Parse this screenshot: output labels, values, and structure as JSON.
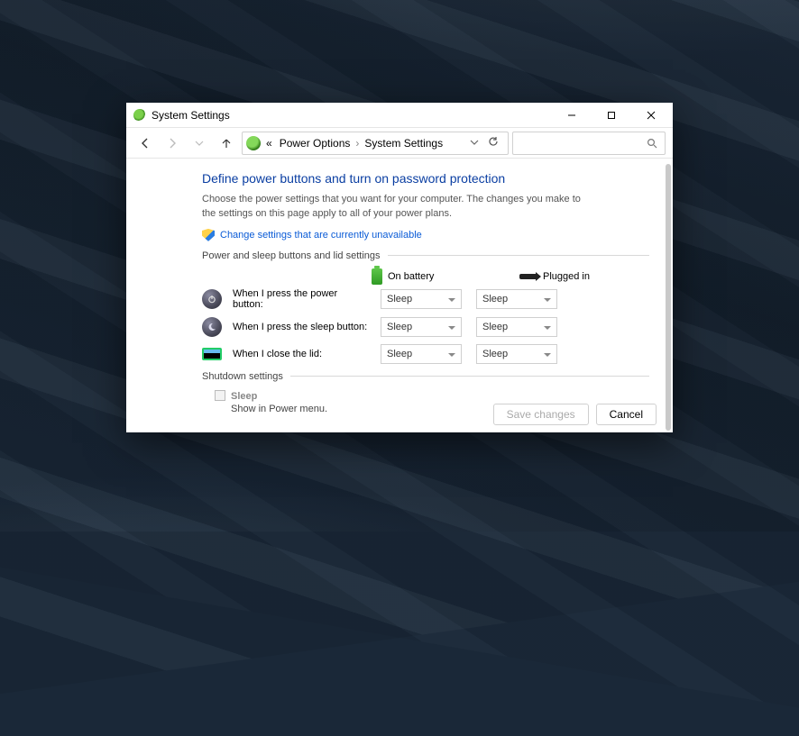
{
  "titlebar": {
    "title": "System Settings"
  },
  "breadcrumb": {
    "root_glyph": "«",
    "p1": "Power Options",
    "p2": "System Settings"
  },
  "heading": "Define power buttons and turn on password protection",
  "description": "Choose the power settings that you want for your computer. The changes you make to the settings on this page apply to all of your power plans.",
  "admin_link": "Change settings that are currently unavailable",
  "section1": "Power and sleep buttons and lid settings",
  "columns": {
    "battery": "On battery",
    "plugged": "Plugged in"
  },
  "rows": [
    {
      "icon": "power-icon",
      "label": "When I press the power button:",
      "battery": "Sleep",
      "plugged": "Sleep"
    },
    {
      "icon": "sleep-icon",
      "label": "When I press the sleep button:",
      "battery": "Sleep",
      "plugged": "Sleep"
    },
    {
      "icon": "lid-icon",
      "label": "When I close the lid:",
      "battery": "Sleep",
      "plugged": "Sleep"
    }
  ],
  "section2": "Shutdown settings",
  "shutdown_option": {
    "title": "Sleep",
    "sub": "Show in Power menu."
  },
  "buttons": {
    "save": "Save changes",
    "cancel": "Cancel"
  }
}
